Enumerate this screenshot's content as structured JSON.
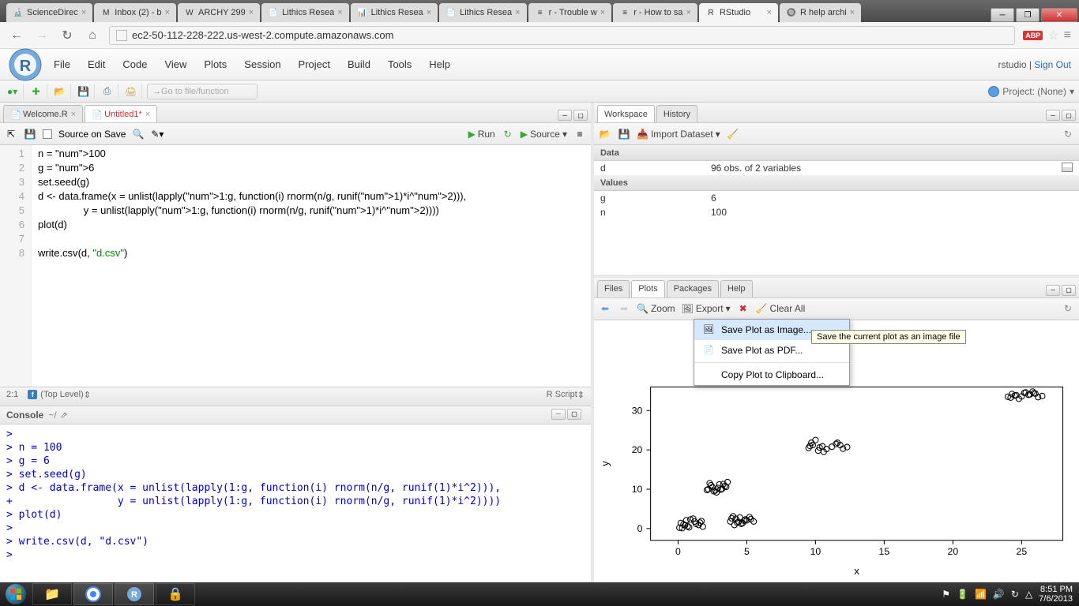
{
  "browser": {
    "tabs": [
      {
        "label": "ScienceDirec",
        "icon": "🔬"
      },
      {
        "label": "Inbox (2) - b",
        "icon": "M"
      },
      {
        "label": "ARCHY 299",
        "icon": "W"
      },
      {
        "label": "Lithics Resea",
        "icon": "📄"
      },
      {
        "label": "Lithics Resea",
        "icon": "📊"
      },
      {
        "label": "Lithics Resea",
        "icon": "📄"
      },
      {
        "label": "r - Trouble w",
        "icon": "≡"
      },
      {
        "label": "r - How to sa",
        "icon": "≡"
      },
      {
        "label": "RStudio",
        "icon": "R",
        "active": true
      },
      {
        "label": "R help archi",
        "icon": "🔘"
      }
    ],
    "url": "ec2-50-112-228-222.us-west-2.compute.amazonaws.com"
  },
  "menubar": {
    "items": [
      "File",
      "Edit",
      "Code",
      "View",
      "Plots",
      "Session",
      "Project",
      "Build",
      "Tools",
      "Help"
    ],
    "user": "rstudio",
    "signout": "Sign Out"
  },
  "toolbar": {
    "goto_placeholder": "Go to file/function",
    "project_label": "Project: (None)"
  },
  "source": {
    "tabs": [
      {
        "label": "Welcome.R"
      },
      {
        "label": "Untitled1*",
        "active": true
      }
    ],
    "source_on_save": "Source on Save",
    "run": "Run",
    "source_btn": "Source",
    "cursor": "2:1",
    "scope": "(Top Level)",
    "mode": "R Script",
    "lines": [
      "n = 100",
      "g = 6",
      "set.seed(g)",
      "d <- data.frame(x = unlist(lapply(1:g, function(i) rnorm(n/g, runif(1)*i^2))),",
      "                y = unlist(lapply(1:g, function(i) rnorm(n/g, runif(1)*i^2))))",
      "plot(d)",
      "",
      "write.csv(d, \"d.csv\")"
    ]
  },
  "console": {
    "title": "Console",
    "path": "~/",
    "lines": [
      ">",
      "> n = 100",
      "> g = 6",
      "> set.seed(g)",
      "> d <- data.frame(x = unlist(lapply(1:g, function(i) rnorm(n/g, runif(1)*i^2))),",
      "+                 y = unlist(lapply(1:g, function(i) rnorm(n/g, runif(1)*i^2))))",
      "> plot(d)",
      ">",
      "> write.csv(d, \"d.csv\")",
      "> "
    ]
  },
  "workspace": {
    "tabs": [
      "Workspace",
      "History"
    ],
    "import": "Import Dataset",
    "sections": {
      "Data": [
        {
          "name": "d",
          "value": "96 obs. of 2 variables",
          "grid": true
        }
      ],
      "Values": [
        {
          "name": "g",
          "value": "6"
        },
        {
          "name": "n",
          "value": "100"
        }
      ]
    }
  },
  "plots": {
    "tabs": [
      "Files",
      "Plots",
      "Packages",
      "Help"
    ],
    "active_tab": "Plots",
    "zoom": "Zoom",
    "export": "Export",
    "clear": "Clear All",
    "menu": {
      "img": "Save Plot as Image...",
      "pdf": "Save Plot as PDF...",
      "clip": "Copy Plot to Clipboard..."
    },
    "tooltip": "Save the current plot as an image file"
  },
  "taskbar": {
    "time": "8:51 PM",
    "date": "7/6/2013"
  },
  "chart_data": {
    "type": "scatter",
    "xlabel": "x",
    "ylabel": "y",
    "xlim": [
      -2,
      28
    ],
    "ylim": [
      -3,
      36
    ],
    "xticks": [
      0,
      5,
      10,
      15,
      20,
      25
    ],
    "yticks": [
      0,
      10,
      20,
      30
    ],
    "series": [
      {
        "name": "d",
        "points": [
          [
            0.1,
            0.2
          ],
          [
            0.4,
            1.1
          ],
          [
            0.8,
            0.3
          ],
          [
            1.2,
            1.8
          ],
          [
            0.6,
            2.1
          ],
          [
            1.5,
            0.9
          ],
          [
            0.2,
            1.4
          ],
          [
            1.8,
            0.5
          ],
          [
            0.9,
            2.3
          ],
          [
            1.3,
            1.2
          ],
          [
            0.5,
            0.8
          ],
          [
            1.7,
            1.9
          ],
          [
            0.3,
            0.1
          ],
          [
            1.1,
            2.5
          ],
          [
            1.6,
            1.5
          ],
          [
            0.7,
            0.6
          ],
          [
            2.1,
            9.8
          ],
          [
            2.5,
            10.5
          ],
          [
            3.0,
            11.2
          ],
          [
            2.8,
            9.2
          ],
          [
            3.4,
            10.8
          ],
          [
            2.3,
            11.5
          ],
          [
            3.2,
            10.1
          ],
          [
            2.6,
            9.5
          ],
          [
            3.6,
            11.8
          ],
          [
            2.9,
            10.3
          ],
          [
            3.1,
            9.9
          ],
          [
            2.4,
            11.0
          ],
          [
            3.5,
            10.6
          ],
          [
            2.7,
            9.7
          ],
          [
            3.3,
            11.3
          ],
          [
            2.2,
            10.0
          ],
          [
            3.8,
            1.8
          ],
          [
            4.2,
            2.5
          ],
          [
            4.6,
            1.2
          ],
          [
            4.0,
            3.1
          ],
          [
            4.8,
            2.0
          ],
          [
            4.3,
            1.5
          ],
          [
            4.5,
            2.8
          ],
          [
            4.1,
            0.9
          ],
          [
            4.9,
            2.3
          ],
          [
            4.4,
            1.7
          ],
          [
            3.9,
            2.6
          ],
          [
            4.7,
            1.4
          ],
          [
            5.0,
            2.1
          ],
          [
            5.2,
            2.9
          ],
          [
            5.5,
            1.8
          ],
          [
            5.3,
            2.4
          ],
          [
            9.5,
            20.5
          ],
          [
            9.8,
            21.2
          ],
          [
            10.2,
            19.8
          ],
          [
            10.5,
            20.9
          ],
          [
            9.7,
            21.8
          ],
          [
            10.8,
            20.2
          ],
          [
            10.0,
            22.5
          ],
          [
            10.3,
            20.6
          ],
          [
            9.6,
            21.0
          ],
          [
            10.6,
            19.5
          ],
          [
            11.2,
            20.8
          ],
          [
            11.5,
            21.5
          ],
          [
            12.0,
            20.3
          ],
          [
            11.8,
            21.2
          ],
          [
            12.3,
            20.7
          ],
          [
            11.6,
            21.8
          ],
          [
            24.0,
            33.5
          ],
          [
            24.3,
            34.2
          ],
          [
            24.8,
            33.0
          ],
          [
            25.2,
            34.5
          ],
          [
            24.5,
            33.8
          ],
          [
            25.5,
            34.0
          ],
          [
            24.2,
            33.3
          ],
          [
            25.8,
            34.8
          ],
          [
            25.0,
            33.6
          ],
          [
            26.0,
            34.3
          ],
          [
            24.6,
            33.9
          ],
          [
            25.3,
            34.6
          ],
          [
            26.2,
            33.4
          ],
          [
            25.6,
            34.1
          ],
          [
            26.5,
            33.7
          ],
          [
            25.9,
            34.4
          ]
        ]
      }
    ]
  }
}
